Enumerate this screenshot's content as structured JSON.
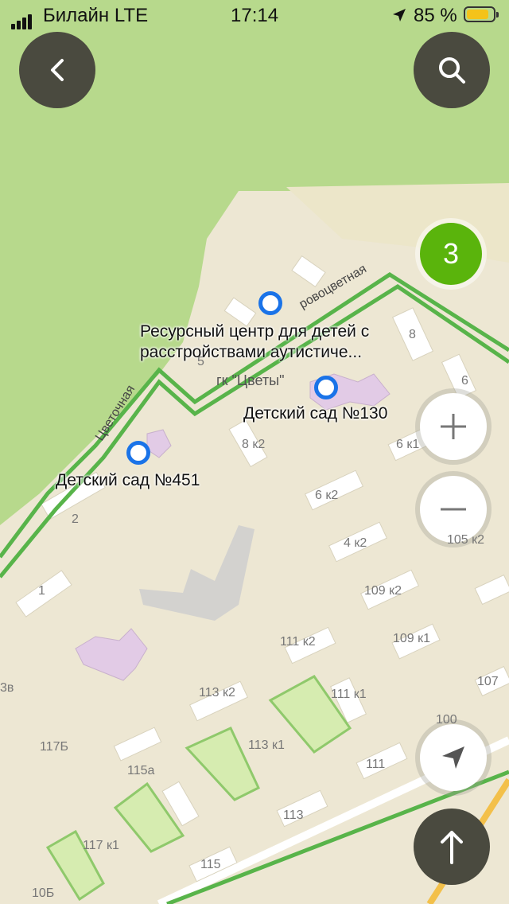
{
  "status_bar": {
    "carrier": "Билайн",
    "network": "LTE",
    "time": "17:14",
    "battery": "85 %",
    "battery_level": 0.85
  },
  "map": {
    "cluster_count": "3",
    "streets": {
      "tsvetochnaya": "Цветочная",
      "partial": "ровоцветная"
    },
    "pois": {
      "resource_center": [
        "Ресурсный центр для детей с",
        "расстройствами аутистиче..."
      ],
      "kindergarten_130": "Детский сад №130",
      "kindergarten_451": "Детский сад №451",
      "gk_tsvety": "гк \"Цветы\""
    },
    "house_numbers": [
      "8",
      "6",
      "5",
      "8 к2",
      "6 к1",
      "6 к2",
      "2",
      "4 к2",
      "105 к2",
      "1",
      "109 к2",
      "111 к2",
      "109 к1",
      "3в",
      "113 к2",
      "111 к1",
      "107",
      "117Б",
      "113 к1",
      "115а",
      "111",
      "100",
      "113",
      "117 к1",
      "115",
      "10Б"
    ]
  },
  "colors": {
    "park": "#b7d98c",
    "urban": "#ede7d3",
    "route": "#58b44a",
    "pin": "#1a73e8",
    "cluster": "#5ab40c",
    "button_dark": "#4a4a3f"
  },
  "icons": {
    "back": "chevron-left-icon",
    "search": "search-icon",
    "zoom_in": "plus-icon",
    "zoom_out": "minus-icon",
    "locate": "navigation-arrow-icon",
    "route": "arrow-up-icon"
  }
}
